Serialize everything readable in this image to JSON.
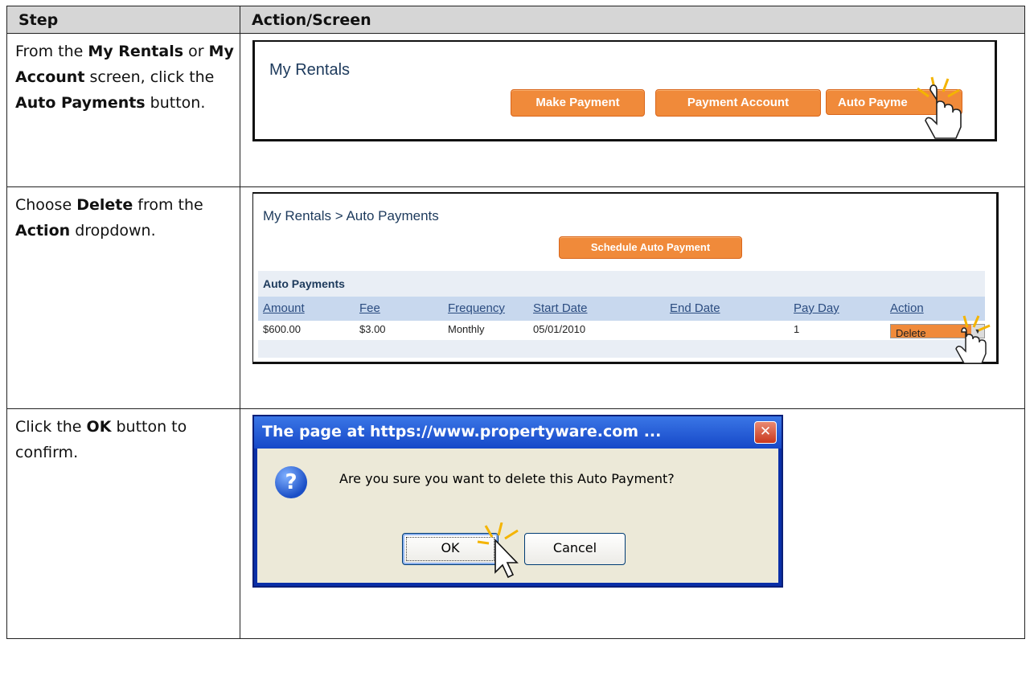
{
  "table": {
    "header_step": "Step",
    "header_action": "Action/Screen"
  },
  "rows": [
    {
      "step_parts": [
        {
          "text": "From the ",
          "bold": false
        },
        {
          "text": "My Rentals",
          "bold": true
        },
        {
          "text": " or ",
          "bold": false
        },
        {
          "text": "My Account",
          "bold": true
        },
        {
          "text": " screen, click the ",
          "bold": false
        },
        {
          "text": "Auto Payments",
          "bold": true
        },
        {
          "text": " button.",
          "bold": false
        }
      ]
    },
    {
      "step_parts": [
        {
          "text": "Choose ",
          "bold": false
        },
        {
          "text": "Delete",
          "bold": true
        },
        {
          "text": " from the ",
          "bold": false
        },
        {
          "text": "Action",
          "bold": true
        },
        {
          "text": " dropdown.",
          "bold": false
        }
      ]
    },
    {
      "step_parts": [
        {
          "text": "Click the ",
          "bold": false
        },
        {
          "text": "OK",
          "bold": true
        },
        {
          "text": " button to confirm.",
          "bold": false
        }
      ]
    }
  ],
  "shot1": {
    "title": "My Rentals",
    "make_payment": "Make Payment",
    "payment_account": "Payment Account",
    "auto_payments": "Auto Payme"
  },
  "shot2": {
    "breadcrumb": "My Rentals > Auto Payments",
    "schedule_button": "Schedule Auto Payment",
    "panel_title": "Auto Payments",
    "columns": [
      "Amount",
      "Fee",
      "Frequency",
      "Start Date",
      "End Date",
      "Pay Day",
      "Action"
    ],
    "row": [
      "$600.00",
      "$3.00",
      "Monthly",
      "05/01/2010",
      "",
      "1"
    ],
    "action_selected": "Delete"
  },
  "shot3": {
    "title": "The page at https://www.propertyware.com ...",
    "close": "✕",
    "icon": "?",
    "message": "Are you sure you want to delete this Auto Payment?",
    "ok": "OK",
    "cancel": "Cancel"
  },
  "colors": {
    "orange_button": "#f08a3a",
    "link_blue": "#2b4c80",
    "titlebar_blue": "#1648c8",
    "dialog_body": "#ece9d8"
  }
}
